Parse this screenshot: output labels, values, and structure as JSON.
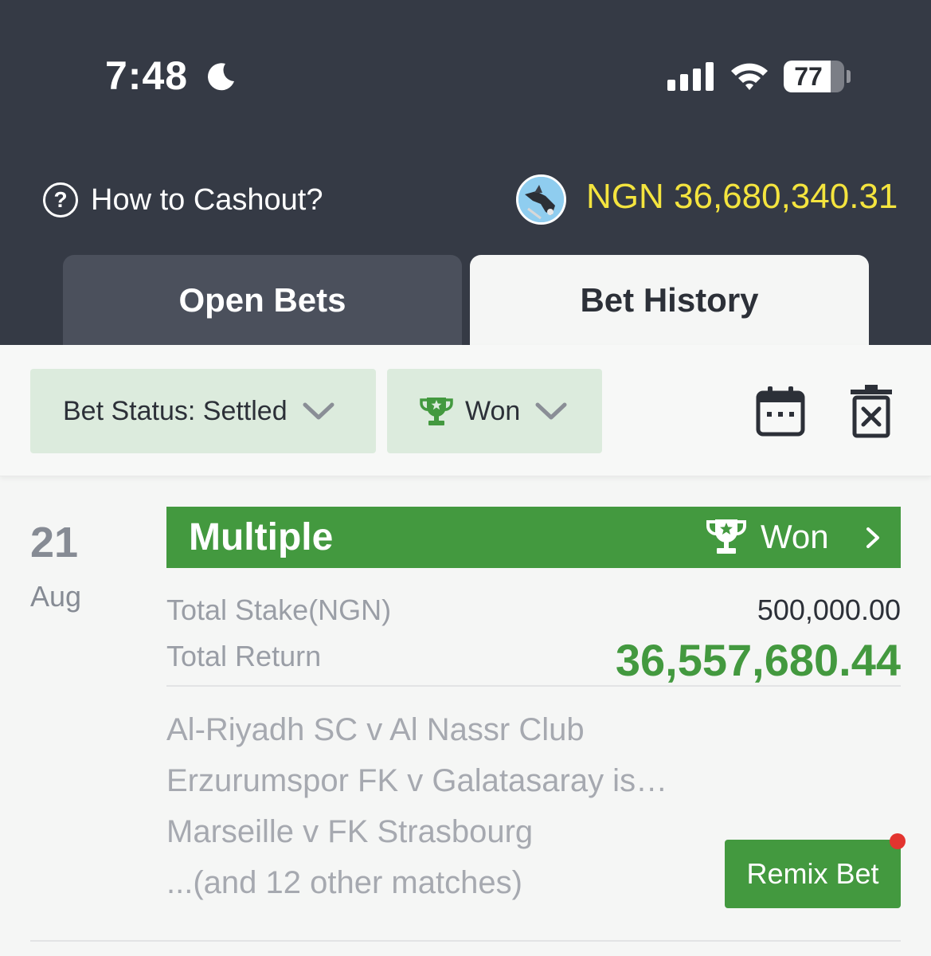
{
  "status_bar": {
    "time": "7:48",
    "battery": "77",
    "battery_level": 0.77,
    "icons": [
      "moon-icon",
      "cellular-signal-icon",
      "wifi-icon",
      "battery-icon"
    ]
  },
  "header": {
    "cashout_label": "How to Cashout?",
    "balance": "NGN 36,680,340.31",
    "balance_color": "#f4e43e"
  },
  "tabs": [
    {
      "label": "Open Bets",
      "active": false
    },
    {
      "label": "Bet History",
      "active": true
    }
  ],
  "filters": {
    "status_label": "Bet Status: Settled",
    "result_label": "Won"
  },
  "bet": {
    "day": "21",
    "month": "Aug",
    "type": "Multiple",
    "result": "Won",
    "stake_label": "Total Stake(NGN)",
    "stake_value": "500,000.00",
    "return_label": "Total Return",
    "return_value": "36,557,680.44",
    "matches": [
      "Al-Riyadh SC v Al Nassr Club",
      "Erzurumspor FK v Galatasaray is…",
      "Marseille v FK Strasbourg",
      "...(and 12 other matches)"
    ],
    "remix_label": "Remix Bet"
  },
  "colors": {
    "header_bg": "#353a45",
    "accent_green": "#43993f",
    "chip_bg": "#dcebdd",
    "notification_dot": "#e3342f"
  }
}
